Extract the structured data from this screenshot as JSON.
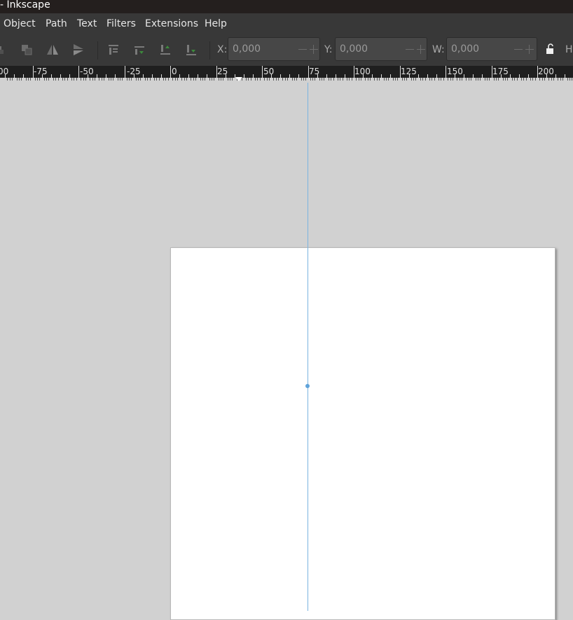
{
  "window": {
    "title": "- Inkscape"
  },
  "menu": {
    "items": [
      "Object",
      "Path",
      "Text",
      "Filters",
      "Extensions",
      "Help"
    ]
  },
  "toolbar": {
    "x": {
      "label": "X:",
      "value": "0,000"
    },
    "y": {
      "label": "Y:",
      "value": "0,000"
    },
    "w": {
      "label": "W:",
      "value": "0,000"
    },
    "h": {
      "label": "H"
    }
  },
  "ruler": {
    "labels": [
      "00",
      "-75",
      "-50",
      "-25",
      "0",
      "25",
      "50",
      "75",
      "100",
      "125",
      "150",
      "175",
      "200"
    ]
  },
  "colors": {
    "chrome": "#383838",
    "title_bg": "#241f1e",
    "canvas": "#d1d1d1",
    "page": "#ffffff",
    "guide": "#7bb4e0"
  }
}
